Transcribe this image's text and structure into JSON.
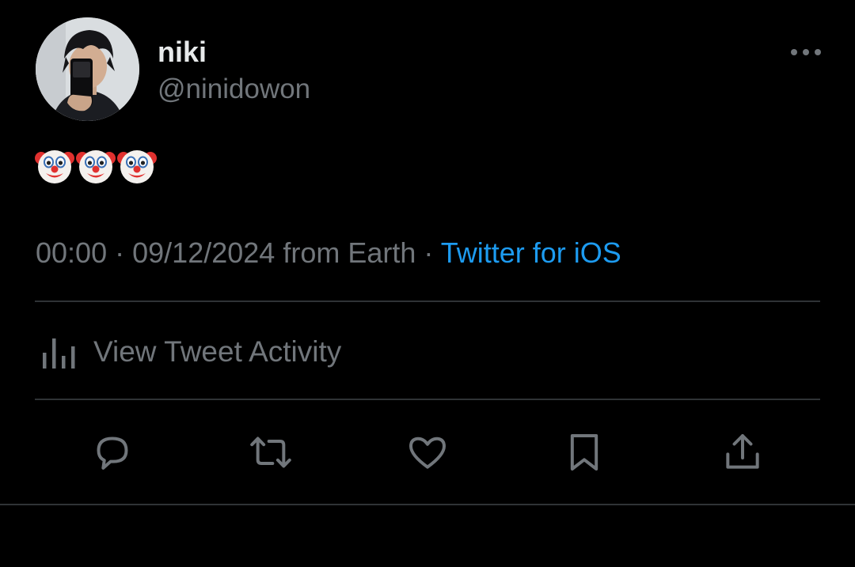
{
  "tweet": {
    "author": {
      "display_name": "niki",
      "handle": "@ninidowon"
    },
    "text_emojis": [
      "clown-face-emoji",
      "clown-face-emoji",
      "clown-face-emoji"
    ],
    "meta": {
      "time": "00:00",
      "separator": "·",
      "date": "09/12/2024",
      "location": "from Earth",
      "source": "Twitter for iOS"
    },
    "activity_label": "View Tweet Activity",
    "actions": [
      {
        "name": "reply",
        "icon": "reply-icon"
      },
      {
        "name": "retweet",
        "icon": "retweet-icon"
      },
      {
        "name": "like",
        "icon": "heart-icon"
      },
      {
        "name": "bookmark",
        "icon": "bookmark-icon"
      },
      {
        "name": "share",
        "icon": "share-icon"
      }
    ]
  },
  "colors": {
    "background": "#000000",
    "primary_text": "#e7e9ea",
    "secondary_text": "#71767b",
    "link": "#1d9bf0",
    "divider": "#2f3336"
  }
}
